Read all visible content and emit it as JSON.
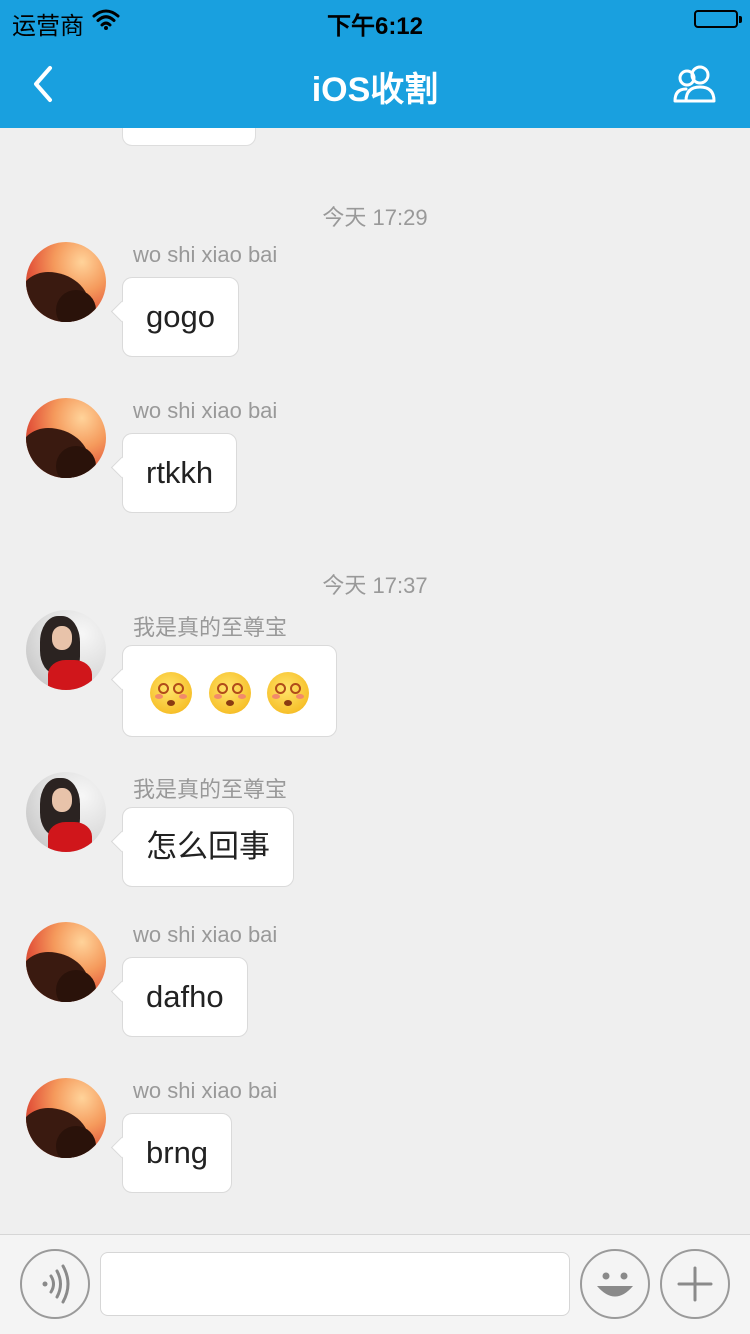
{
  "status_bar": {
    "carrier": "运营商",
    "time": "下午6:12"
  },
  "nav": {
    "title": "iOS收割"
  },
  "messages": [
    {
      "type": "timestamp",
      "text": "今天  17:29"
    },
    {
      "type": "message",
      "sender": "wo shi xiao bai",
      "avatar": "sunset-avatar",
      "text": "gogo"
    },
    {
      "type": "message",
      "sender": "wo shi xiao bai",
      "avatar": "sunset-avatar",
      "text": "rtkkh"
    },
    {
      "type": "timestamp",
      "text": "今天  17:37"
    },
    {
      "type": "message",
      "sender": "我是真的至尊宝",
      "avatar": "woman-avatar",
      "emoji": [
        "dizzy-face-emoji",
        "dizzy-face-emoji",
        "dizzy-face-emoji"
      ]
    },
    {
      "type": "message",
      "sender": "我是真的至尊宝",
      "avatar": "woman-avatar",
      "text": "怎么回事"
    },
    {
      "type": "message",
      "sender": "wo shi xiao bai",
      "avatar": "sunset-avatar",
      "text": "dafho"
    },
    {
      "type": "message",
      "sender": "wo shi xiao bai",
      "avatar": "sunset-avatar",
      "text": "brng"
    }
  ],
  "input_bar": {
    "text_value": "",
    "icons": [
      "voice-icon",
      "emoji-icon",
      "plus-icon"
    ]
  },
  "colors": {
    "nav_background": "#19a0df",
    "chat_background": "#efefef",
    "bubble_background": "#ffffff",
    "meta_text": "#999999"
  }
}
